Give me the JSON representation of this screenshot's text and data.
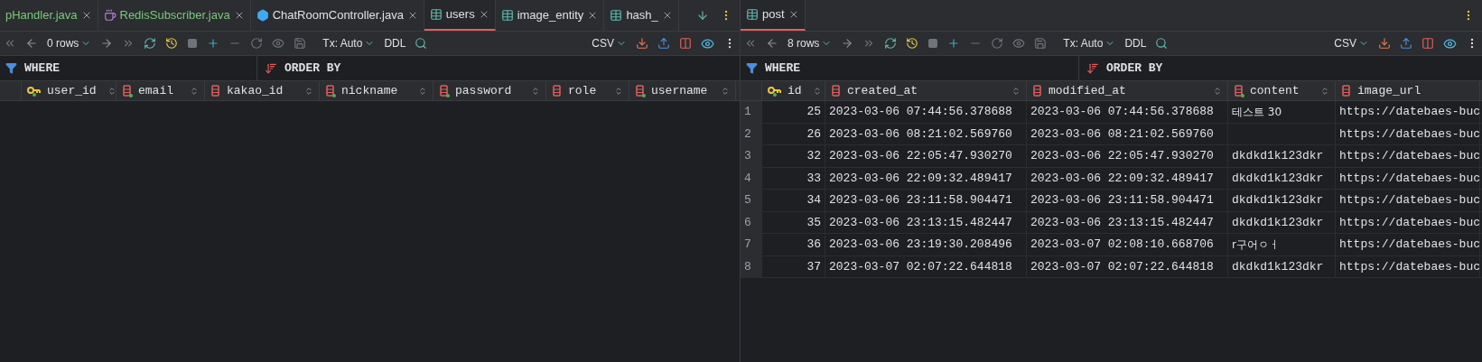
{
  "panes": [
    {
      "tabs": [
        {
          "label": "pHandler.java",
          "kind": "none",
          "added": true,
          "selected": false
        },
        {
          "label": "RedisSubscriber.java",
          "kind": "java",
          "added": true,
          "selected": false
        },
        {
          "label": "ChatRoomController.java",
          "kind": "class",
          "added": false,
          "selected": false
        },
        {
          "label": "users",
          "kind": "table",
          "added": false,
          "selected": true
        },
        {
          "label": "image_entity",
          "kind": "table",
          "added": false,
          "selected": false
        },
        {
          "label": "hash_",
          "kind": "table",
          "added": false,
          "selected": false
        }
      ],
      "more_tabs": true,
      "toolbar": {
        "rows": "0 rows",
        "tx": "Tx: Auto",
        "ddl": "DDL",
        "format": "CSV"
      },
      "filter": {
        "where": "WHERE",
        "order": "ORDER BY"
      },
      "columns": [
        {
          "name": "user_id",
          "kind": "key",
          "not_null": true,
          "sort_icon": true
        },
        {
          "name": "email",
          "kind": "column",
          "not_null": true,
          "sort_icon": true
        },
        {
          "name": "kakao_id",
          "kind": "column",
          "not_null": false,
          "sort_icon": true
        },
        {
          "name": "nickname",
          "kind": "column",
          "not_null": true,
          "sort_icon": true
        },
        {
          "name": "password",
          "kind": "column",
          "not_null": true,
          "sort_icon": true
        },
        {
          "name": "role",
          "kind": "column",
          "not_null": false,
          "sort_icon": true
        },
        {
          "name": "username",
          "kind": "column",
          "not_null": true,
          "sort_icon": true
        }
      ]
    },
    {
      "tabs": [
        {
          "label": "post",
          "kind": "table",
          "added": false,
          "selected": true
        }
      ],
      "more_tabs": false,
      "toolbar": {
        "rows": "8 rows",
        "tx": "Tx: Auto",
        "ddl": "DDL",
        "format": "CSV"
      },
      "filter": {
        "where": "WHERE",
        "order": "ORDER BY"
      },
      "columns": [
        {
          "name": "id",
          "kind": "key",
          "not_null": true,
          "sort_icon": true
        },
        {
          "name": "created_at",
          "kind": "column",
          "not_null": false,
          "sort_icon": true
        },
        {
          "name": "modified_at",
          "kind": "column",
          "not_null": false,
          "sort_icon": true
        },
        {
          "name": "content",
          "kind": "column",
          "not_null": true,
          "sort_icon": true
        },
        {
          "name": "image_url",
          "kind": "column",
          "not_null": false,
          "sort_icon": false
        }
      ],
      "rows": [
        {
          "number": "1",
          "cells": [
            "25",
            "2023-03-06 07:44:56.378688",
            "2023-03-06 07:44:56.378688",
            "테스트 30",
            "https://datebaes-buc"
          ]
        },
        {
          "number": "2",
          "cells": [
            "26",
            "2023-03-06 08:21:02.569760",
            "2023-03-06 08:21:02.569760",
            null,
            "https://datebaes-buc"
          ]
        },
        {
          "number": "3",
          "cells": [
            "32",
            "2023-03-06 22:05:47.930270",
            "2023-03-06 22:05:47.930270",
            "dkdkd1k123dkr",
            "https://datebaes-buc"
          ]
        },
        {
          "number": "4",
          "cells": [
            "33",
            "2023-03-06 22:09:32.489417",
            "2023-03-06 22:09:32.489417",
            "dkdkd1k123dkr",
            "https://datebaes-buc"
          ]
        },
        {
          "number": "5",
          "cells": [
            "34",
            "2023-03-06 23:11:58.904471",
            "2023-03-06 23:11:58.904471",
            "dkdkd1k123dkr",
            "https://datebaes-buc"
          ]
        },
        {
          "number": "6",
          "cells": [
            "35",
            "2023-03-06 23:13:15.482447",
            "2023-03-06 23:13:15.482447",
            "dkdkd1k123dkr",
            "https://datebaes-buc"
          ]
        },
        {
          "number": "7",
          "cells": [
            "36",
            "2023-03-06 23:19:30.208496",
            "2023-03-07 02:08:10.668706",
            "r구어ㅇㅓ",
            "https://datebaes-buc"
          ]
        },
        {
          "number": "8",
          "cells": [
            "37",
            "2023-03-07 02:07:22.644818",
            "2023-03-07 02:07:22.644818",
            "dkdkd1k123dkr",
            "https://datebaes-buc"
          ]
        }
      ]
    }
  ]
}
